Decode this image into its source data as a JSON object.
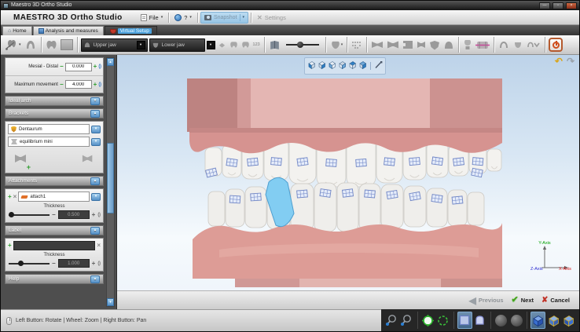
{
  "window": {
    "title": "Maestro 3D Ortho Studio"
  },
  "menubar": {
    "brand": "MAESTRO 3D Ortho Studio",
    "file": "File",
    "help": "?",
    "snapshot": "Snapshot",
    "settings": "Settings"
  },
  "tabs": {
    "home": "Home",
    "analysis": "Analysis and measures",
    "virtual_setup": "Virtual Setup"
  },
  "toolbar": {
    "upper_jaw": "Upper jaw",
    "lower_jaw": "Lower jaw",
    "numbers_label": "123"
  },
  "sidebar": {
    "mesial_distal": {
      "label": "Mesial - Distal",
      "value": "0.000"
    },
    "maximum_movement": {
      "label": "Maximum movement",
      "value": "4.000"
    },
    "sections": {
      "ideal_arch": "Ideal arch",
      "brackets": "Brackets",
      "attachments": "Attachments",
      "label": "Label",
      "help": "Help"
    },
    "brackets": {
      "vendor": "Dentaurum",
      "system": "equilibrium mini"
    },
    "attachments": {
      "selected": "attach1",
      "thickness_label": "Thickness",
      "thickness_value": "0.500"
    },
    "label_panel": {
      "text_value": "",
      "thickness_label": "Thickness",
      "thickness_value": "1.000"
    }
  },
  "viewport": {
    "axis": {
      "x": "X-Axis",
      "y": "Y-Axis",
      "z": "Z-Axis"
    }
  },
  "nav": {
    "previous": "Previous",
    "next": "Next",
    "cancel": "Cancel"
  },
  "statusbar": {
    "hint": "Left Button: Rotate | Wheel: Zoom | Right Button: Pan"
  },
  "glyphs": {
    "caret_down": "▾",
    "caret_up": "▴",
    "minus": "−",
    "plus": "+",
    "cycle": "( )",
    "close_x": "×",
    "check": "✔",
    "cross": "✘",
    "undo": "↶",
    "redo": "↷",
    "minimize": "—",
    "maximize": "▫",
    "win_close": "×",
    "home": "⌂",
    "prev_arrow": "◀",
    "settings_x": "✕"
  },
  "colors": {
    "accent_blue": "#5b9bd0",
    "highlight_tooth": "#82cdf2",
    "bracket_blue": "#6f85c5",
    "power_orange": "#cf4f1e",
    "next_green": "#46a41c",
    "cancel_red": "#c13227"
  }
}
